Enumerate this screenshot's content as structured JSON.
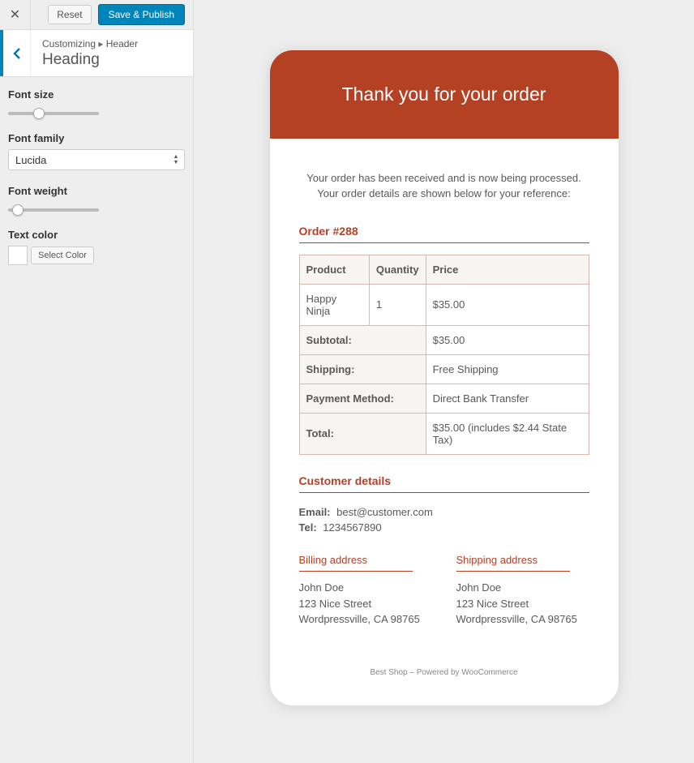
{
  "top": {
    "reset": "Reset",
    "save": "Save & Publish"
  },
  "crumb": {
    "prefix": "Customizing",
    "section": "Header",
    "title": "Heading"
  },
  "controls": {
    "font_size_label": "Font size",
    "font_family_label": "Font family",
    "font_family_value": "Lucida",
    "font_weight_label": "Font weight",
    "text_color_label": "Text color",
    "select_color": "Select Color"
  },
  "email": {
    "header": "Thank you for your order",
    "intro_l1": "Your order has been received and is now being processed.",
    "intro_l2": "Your order details are shown below for your reference:",
    "order_heading": "Order #288",
    "cols": {
      "product": "Product",
      "qty": "Quantity",
      "price": "Price"
    },
    "item": {
      "name": "Happy Ninja",
      "qty": "1",
      "price": "$35.00"
    },
    "rows": {
      "subtotal_l": "Subtotal:",
      "subtotal_v": "$35.00",
      "shipping_l": "Shipping:",
      "shipping_v": "Free Shipping",
      "payment_l": "Payment Method:",
      "payment_v": "Direct Bank Transfer",
      "total_l": "Total:",
      "total_v": "$35.00 (includes $2.44 State Tax)"
    },
    "cust_heading": "Customer details",
    "email_l": "Email:",
    "email_v": "best@customer.com",
    "tel_l": "Tel:",
    "tel_v": "1234567890",
    "billing_h": "Billing address",
    "shipping_h": "Shipping address",
    "billing": {
      "name": "John Doe",
      "street": "123 Nice Street",
      "city": "Wordpressville, CA 98765"
    },
    "shipping": {
      "name": "John Doe",
      "street": "123 Nice Street",
      "city": "Wordpressville, CA 98765"
    },
    "footer": "Best Shop – Powered by WooCommerce"
  }
}
